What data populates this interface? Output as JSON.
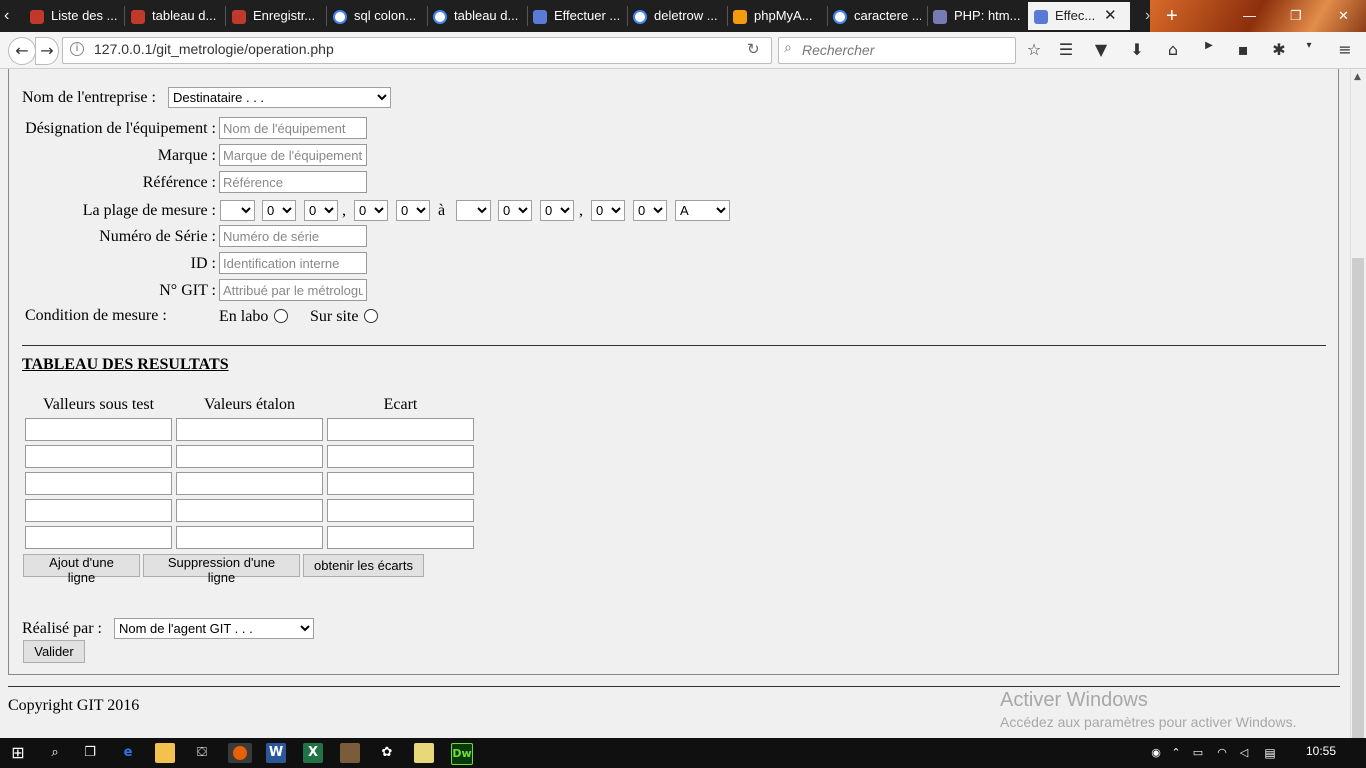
{
  "browser": {
    "tabs": [
      {
        "title": "Liste des ...",
        "icon": "site-icon",
        "color": "#c0392b"
      },
      {
        "title": "tableau d...",
        "icon": "site-icon",
        "color": "#c0392b"
      },
      {
        "title": "Enregistr...",
        "icon": "site-icon",
        "color": "#c0392b"
      },
      {
        "title": "sql colon...",
        "icon": "google-icon",
        "color": "#4285f4"
      },
      {
        "title": "tableau d...",
        "icon": "google-icon",
        "color": "#4285f4"
      },
      {
        "title": "Effectuer ...",
        "icon": "app-icon",
        "color": "#5a7bd5"
      },
      {
        "title": "deletrow ...",
        "icon": "google-icon",
        "color": "#4285f4"
      },
      {
        "title": "phpMyA...",
        "icon": "phpmyadmin-icon",
        "color": "#f39c12"
      },
      {
        "title": "caractere ...",
        "icon": "google-icon",
        "color": "#4285f4"
      },
      {
        "title": "PHP: htm...",
        "icon": "php-icon",
        "color": "#777bb3"
      },
      {
        "title": "Effec...",
        "icon": "app-icon",
        "color": "#5a7bd5"
      }
    ],
    "url": "127.0.0.1/git_metrologie/operation.php",
    "search_placeholder": "Rechercher"
  },
  "form": {
    "entreprise_label": "Nom de l'entreprise :",
    "entreprise_value": "Destinataire . . .",
    "designation_label": "Désignation de l'équipement :",
    "designation_placeholder": "Nom de l'équipement",
    "marque_label": "Marque :",
    "marque_placeholder": "Marque de l'équipement",
    "reference_label": "Référence :",
    "reference_placeholder": "Référence",
    "plage_label": "La plage de mesure :",
    "plage_comma": ",",
    "plage_a": "à",
    "plage_selects": [
      "",
      "0",
      "0",
      "0",
      "0",
      "",
      "0",
      "0",
      "0",
      "0",
      "A"
    ],
    "serie_label": "Numéro de Série :",
    "serie_placeholder": "Numéro de série",
    "id_label": "ID :",
    "id_placeholder": "Identification interne",
    "git_label": "N° GIT :",
    "git_placeholder": "Attribué par le métrologue",
    "condition_label": "Condition de mesure :",
    "labo_label": "En labo",
    "site_label": "Sur site"
  },
  "results": {
    "title": "TABLEAU DES RESULTATS",
    "col1": "Valleurs sous test",
    "col2": "Valeurs étalon",
    "col3": "Ecart",
    "rows": 5,
    "add_button": "Ajout d'une ligne",
    "delete_button": "Suppression d'une ligne",
    "compute_button": "obtenir les écarts"
  },
  "footer_form": {
    "realise_label": "Réalisé par :",
    "agent_value": "Nom de l'agent GIT . . .",
    "submit": "Valider"
  },
  "copyright": "Copyright GIT 2016",
  "watermark": {
    "line1": "Activer Windows",
    "line2": "Accédez aux paramètres pour activer Windows."
  },
  "taskbar": {
    "time": "10:55"
  }
}
